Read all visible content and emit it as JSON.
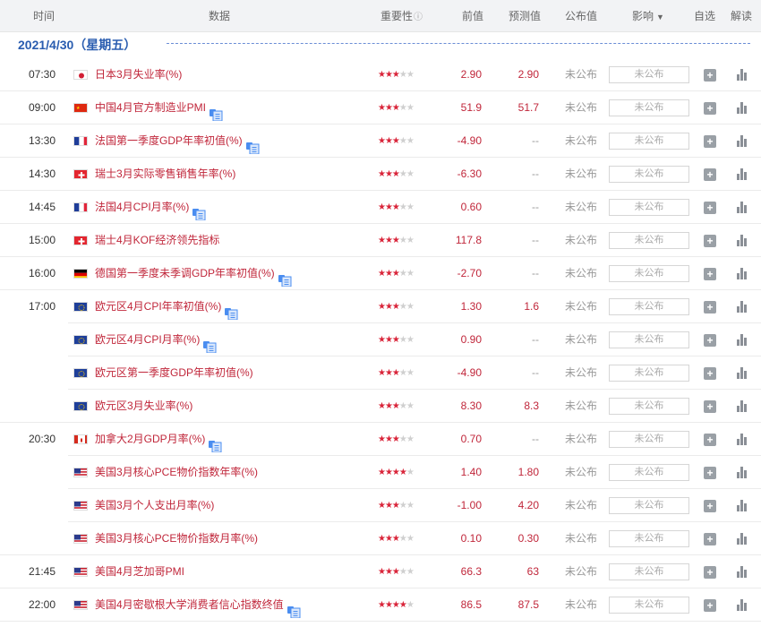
{
  "header": {
    "time": "时间",
    "data": "数据",
    "importance": "重要性",
    "info_icon": "ⓘ",
    "previous": "前值",
    "forecast": "预测值",
    "published": "公布值",
    "impact": "影响",
    "impact_arrow": "▼",
    "watch": "自选",
    "analysis": "解读"
  },
  "date": "2021/4/30（星期五）",
  "colors": {
    "accent_red": "#c0263a",
    "star_red": "#d9253a",
    "date_blue": "#2a5db0"
  },
  "rows": [
    {
      "time": "07:30",
      "flag": "jp",
      "name": "日本3月失业率(%)",
      "doc": false,
      "stars": 3,
      "prev": "2.90",
      "forecast": "2.90",
      "published": "未公布",
      "impact": "未公布"
    },
    {
      "time": "09:00",
      "flag": "cn",
      "name": "中国4月官方制造业PMI",
      "doc": true,
      "stars": 3,
      "prev": "51.9",
      "forecast": "51.7",
      "published": "未公布",
      "impact": "未公布"
    },
    {
      "time": "13:30",
      "flag": "fr",
      "name": "法国第一季度GDP年率初值(%)",
      "doc": true,
      "stars": 3,
      "prev": "-4.90",
      "forecast": "--",
      "published": "未公布",
      "impact": "未公布"
    },
    {
      "time": "14:30",
      "flag": "ch",
      "name": "瑞士3月实际零售销售年率(%)",
      "doc": false,
      "stars": 3,
      "prev": "-6.30",
      "forecast": "--",
      "published": "未公布",
      "impact": "未公布"
    },
    {
      "time": "14:45",
      "flag": "fr",
      "name": "法国4月CPI月率(%)",
      "doc": true,
      "stars": 3,
      "prev": "0.60",
      "forecast": "--",
      "published": "未公布",
      "impact": "未公布"
    },
    {
      "time": "15:00",
      "flag": "ch",
      "name": "瑞士4月KOF经济领先指标",
      "doc": false,
      "stars": 3,
      "prev": "117.8",
      "forecast": "--",
      "published": "未公布",
      "impact": "未公布"
    },
    {
      "time": "16:00",
      "flag": "de",
      "name": "德国第一季度未季调GDP年率初值(%)",
      "doc": true,
      "stars": 3,
      "prev": "-2.70",
      "forecast": "--",
      "published": "未公布",
      "impact": "未公布"
    },
    {
      "time": "17:00",
      "flag": "eu",
      "name": "欧元区4月CPI年率初值(%)",
      "doc": true,
      "stars": 3,
      "prev": "1.30",
      "forecast": "1.6",
      "published": "未公布",
      "impact": "未公布"
    },
    {
      "time": "",
      "flag": "eu",
      "name": "欧元区4月CPI月率(%)",
      "doc": true,
      "stars": 3,
      "prev": "0.90",
      "forecast": "--",
      "published": "未公布",
      "impact": "未公布"
    },
    {
      "time": "",
      "flag": "eu",
      "name": "欧元区第一季度GDP年率初值(%)",
      "doc": false,
      "stars": 3,
      "prev": "-4.90",
      "forecast": "--",
      "published": "未公布",
      "impact": "未公布"
    },
    {
      "time": "",
      "flag": "eu",
      "name": "欧元区3月失业率(%)",
      "doc": false,
      "stars": 3,
      "prev": "8.30",
      "forecast": "8.3",
      "published": "未公布",
      "impact": "未公布"
    },
    {
      "time": "20:30",
      "flag": "ca",
      "name": "加拿大2月GDP月率(%)",
      "doc": true,
      "stars": 3,
      "prev": "0.70",
      "forecast": "--",
      "published": "未公布",
      "impact": "未公布"
    },
    {
      "time": "",
      "flag": "us",
      "name": "美国3月核心PCE物价指数年率(%)",
      "doc": false,
      "stars": 4,
      "prev": "1.40",
      "forecast": "1.80",
      "published": "未公布",
      "impact": "未公布"
    },
    {
      "time": "",
      "flag": "us",
      "name": "美国3月个人支出月率(%)",
      "doc": false,
      "stars": 3,
      "prev": "-1.00",
      "forecast": "4.20",
      "published": "未公布",
      "impact": "未公布"
    },
    {
      "time": "",
      "flag": "us",
      "name": "美国3月核心PCE物价指数月率(%)",
      "doc": false,
      "stars": 3,
      "prev": "0.10",
      "forecast": "0.30",
      "published": "未公布",
      "impact": "未公布"
    },
    {
      "time": "21:45",
      "flag": "us",
      "name": "美国4月芝加哥PMI",
      "doc": false,
      "stars": 3,
      "prev": "66.3",
      "forecast": "63",
      "published": "未公布",
      "impact": "未公布"
    },
    {
      "time": "22:00",
      "flag": "us",
      "name": "美国4月密歇根大学消费者信心指数终值",
      "doc": true,
      "stars": 4,
      "prev": "86.5",
      "forecast": "87.5",
      "published": "未公布",
      "impact": "未公布"
    }
  ]
}
